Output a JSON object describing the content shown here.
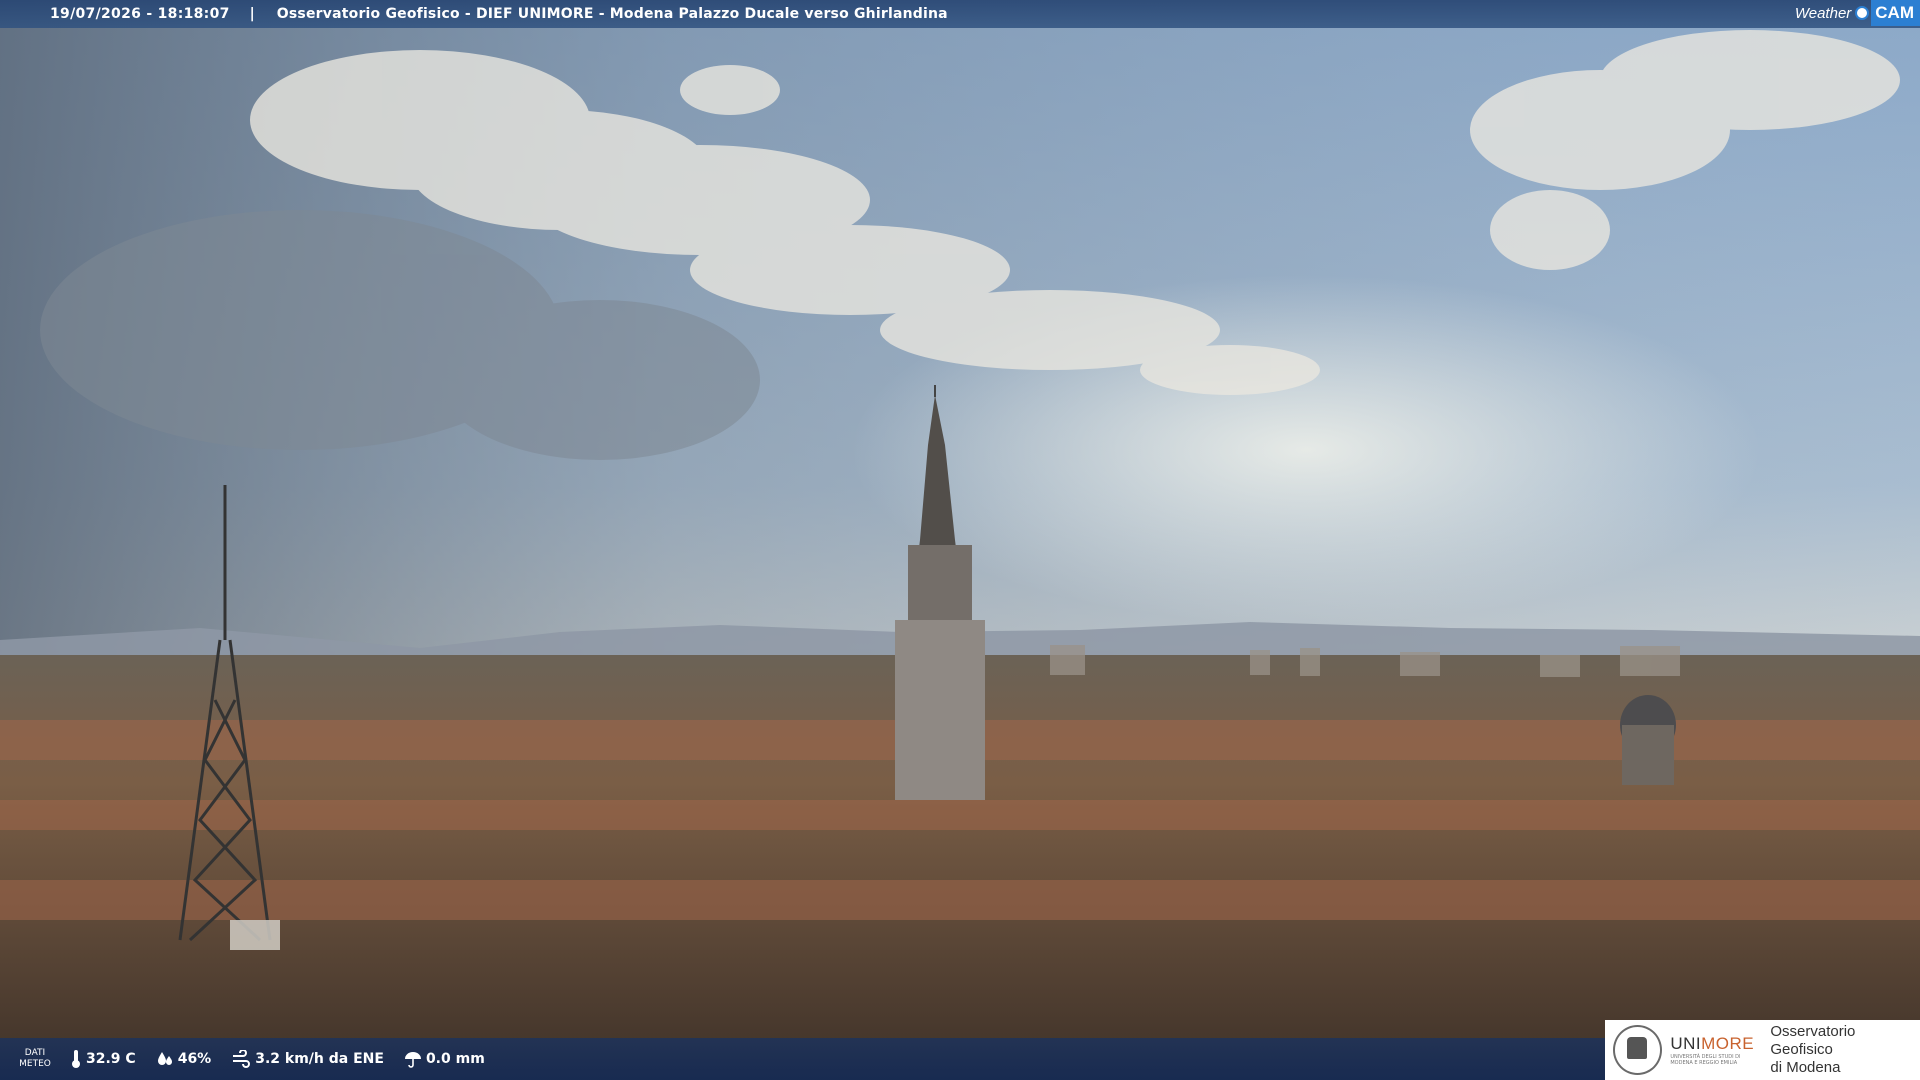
{
  "header": {
    "timestamp": "19/07/2026 - 18:18:07",
    "separator": "|",
    "title": "Osservatorio Geofisico - DIEF UNIMORE - Modena Palazzo Ducale verso Ghirlandina"
  },
  "brand": {
    "weather": "Weather",
    "cam": "CAM"
  },
  "meteo": {
    "label_line1": "DATI",
    "label_line2": "METEO",
    "temperature": "32.9 C",
    "humidity": "46%",
    "wind": "3.2 km/h da ENE",
    "rain": "0.0 mm"
  },
  "logo": {
    "uni": "UNI",
    "more": "MORE",
    "sub": "UNIVERSITÀ DEGLI STUDI DI MODENA E REGGIO EMILIA",
    "observatory_line1": "Osservatorio Geofisico",
    "observatory_line2": "di Modena"
  },
  "colors": {
    "bar": "#2c4c80",
    "accent": "#2c7fd2",
    "unimore_orange": "#c8622e"
  }
}
